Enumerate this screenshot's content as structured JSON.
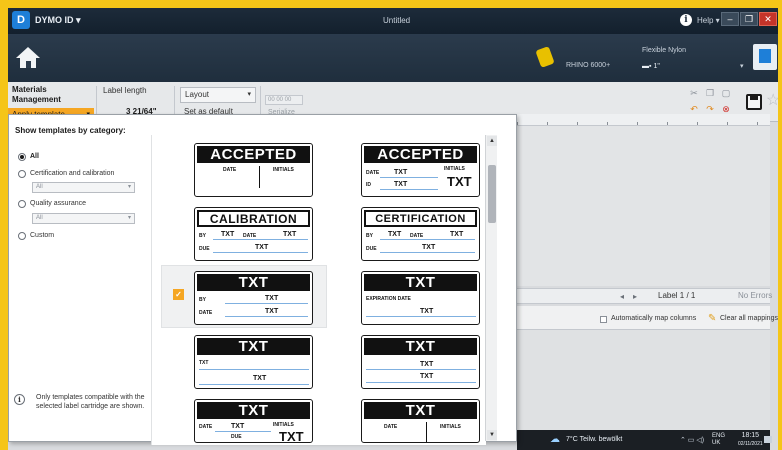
{
  "titlebar": {
    "app_name": "DYMO ID",
    "app_caret": "▾",
    "title": "Untitled",
    "help": "Help ▾"
  },
  "toolbar": {
    "printer": "RHINO 6000+",
    "cartridge_name": "Flexible Nylon",
    "cartridge_size": "1\"",
    "cartridge_caret": "▾"
  },
  "propbar": {
    "materials_management": "Materials Management",
    "apply_template": "Apply template",
    "label_length_label": "Label length",
    "label_length_value": "3 21/64\"",
    "layout_label": "Layout",
    "set_default": "Set as default",
    "serial_field": "00 00 00",
    "serialize": "Serialize"
  },
  "templates_panel": {
    "heading": "Show templates by category:",
    "categories": [
      {
        "label": "All",
        "selected": true
      },
      {
        "label": "Certification and calibration",
        "selected": false
      },
      {
        "label": "Quality assurance",
        "selected": false
      },
      {
        "label": "Custom",
        "selected": false
      }
    ],
    "cert_filter": "All",
    "qa_filter": "All",
    "note": "Only templates compatible with the selected label cartridge are shown."
  },
  "templates": {
    "accepted": "ACCEPTED",
    "calibration": "CALIBRATION",
    "certification": "CERTIFICATION",
    "txt": "TXT",
    "date": "DATE",
    "initials": "INITIALS",
    "id": "ID",
    "by": "BY",
    "due": "DUE",
    "expiration_date": "EXPIRATION DATE",
    "selected_index": 4
  },
  "editor": {
    "label_counter": "Label 1 / 1",
    "errors": "No Errors",
    "auto_map": "Automatically map columns",
    "clear_mappings": "Clear all mappings"
  },
  "taskbar": {
    "weather": "7°C  Teilw. bewölkt",
    "lang_top": "ENG",
    "lang_bottom": "UK",
    "time": "18:15",
    "date": "02/11/2021"
  }
}
